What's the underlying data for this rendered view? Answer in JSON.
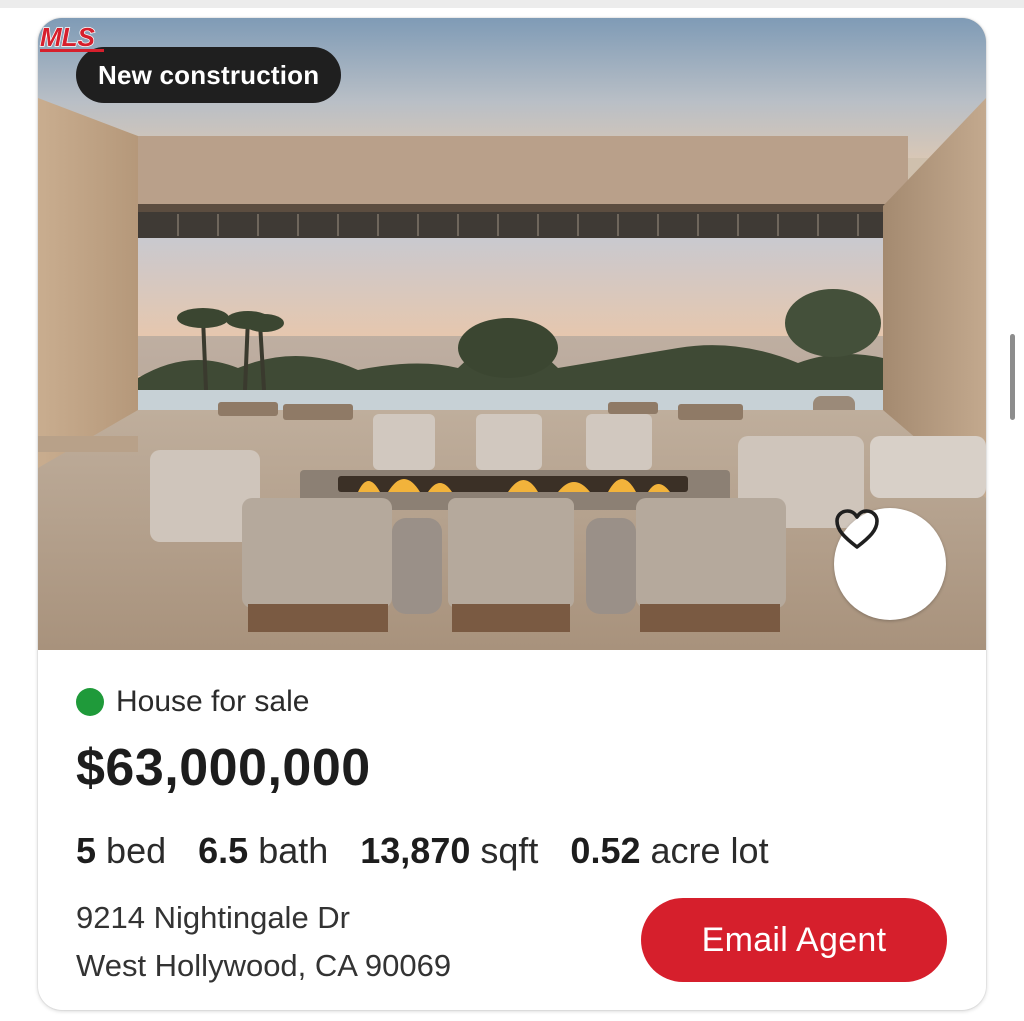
{
  "listing": {
    "badge": "New construction",
    "status_text": "House for sale",
    "status_color": "#1f9a3a",
    "price": "$63,000,000",
    "facts": [
      {
        "value": "5",
        "unit": "bed"
      },
      {
        "value": "6.5",
        "unit": "bath"
      },
      {
        "value": "13,870",
        "unit": "sqft"
      },
      {
        "value": "0.52",
        "unit": "acre lot"
      }
    ],
    "address_line1": "9214 Nightingale Dr",
    "address_line2": "West Hollywood, CA 90069",
    "email_button": "Email Agent",
    "accent_color": "#d61f2c",
    "logo_text": "MLS"
  },
  "icons": {
    "favorite": "heart-outline-icon",
    "mls": "mls-logo"
  }
}
